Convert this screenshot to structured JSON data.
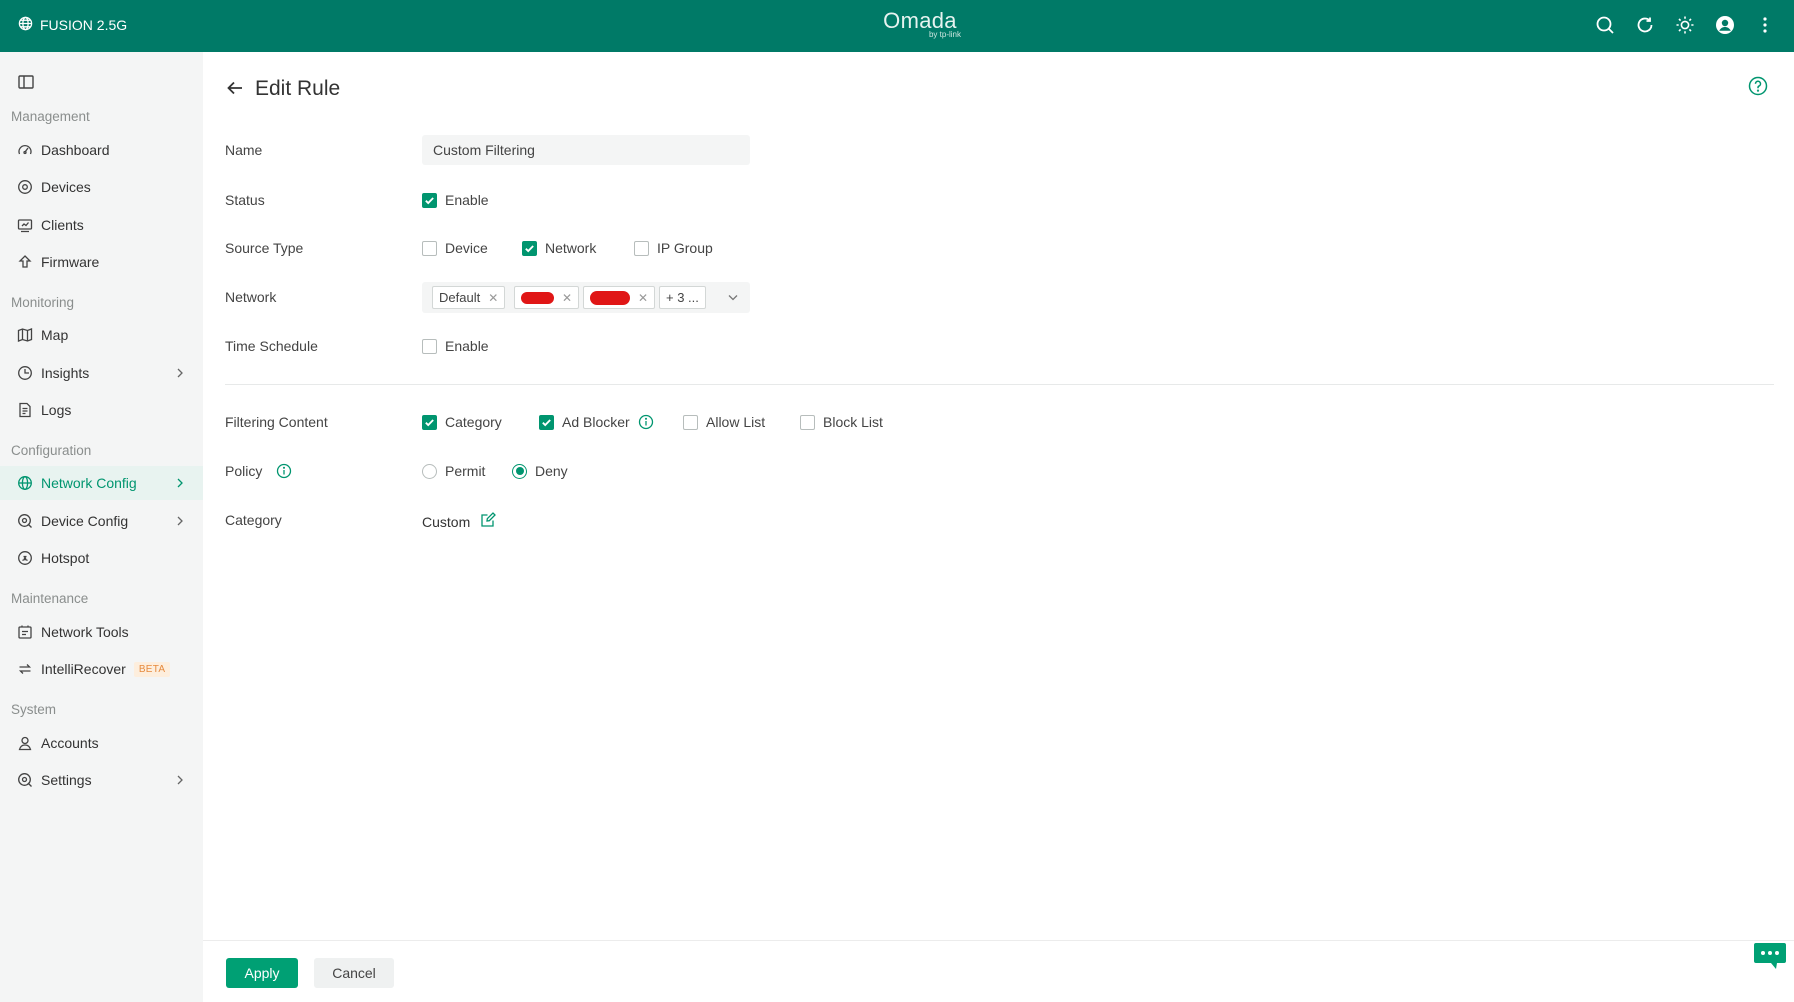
{
  "header": {
    "site_name": "FUSION 2.5G",
    "brand": "Omada",
    "brand_sub": "by tp-link"
  },
  "sidebar": {
    "sections": {
      "management": "Management",
      "monitoring": "Monitoring",
      "configuration": "Configuration",
      "maintenance": "Maintenance",
      "system": "System"
    },
    "items": {
      "dashboard": "Dashboard",
      "devices": "Devices",
      "clients": "Clients",
      "firmware": "Firmware",
      "map": "Map",
      "insights": "Insights",
      "logs": "Logs",
      "network_config": "Network Config",
      "device_config": "Device Config",
      "hotspot": "Hotspot",
      "network_tools": "Network Tools",
      "intellirecover": "IntelliRecover",
      "intellirecover_badge": "BETA",
      "accounts": "Accounts",
      "settings": "Settings"
    },
    "active_item": "Network Config"
  },
  "page": {
    "title": "Edit Rule",
    "labels": {
      "name": "Name",
      "status": "Status",
      "source_type": "Source Type",
      "network": "Network",
      "time_schedule": "Time Schedule",
      "filtering_content": "Filtering Content",
      "policy": "Policy",
      "category": "Category"
    },
    "name_value": "Custom Filtering",
    "status_option": "Enable",
    "status_checked": true,
    "source_type_options": {
      "device": "Device",
      "network": "Network",
      "ip_group": "IP Group"
    },
    "source_type_selected": "Network",
    "network_tags": {
      "tag1": "Default",
      "more": "+ 3 ..."
    },
    "time_schedule_option": "Enable",
    "time_schedule_checked": false,
    "filtering_options": {
      "category": "Category",
      "ad_blocker": "Ad Blocker",
      "allow_list": "Allow List",
      "block_list": "Block List"
    },
    "filtering_checked": [
      "Category",
      "Ad Blocker"
    ],
    "policy_options": {
      "permit": "Permit",
      "deny": "Deny"
    },
    "policy_selected": "Deny",
    "category_value": "Custom"
  },
  "footer": {
    "apply": "Apply",
    "cancel": "Cancel"
  },
  "colors": {
    "header_bg": "#007a67",
    "accent": "#00956f",
    "apply_bg": "#00a074",
    "sidebar_bg": "#f4f5f5"
  }
}
